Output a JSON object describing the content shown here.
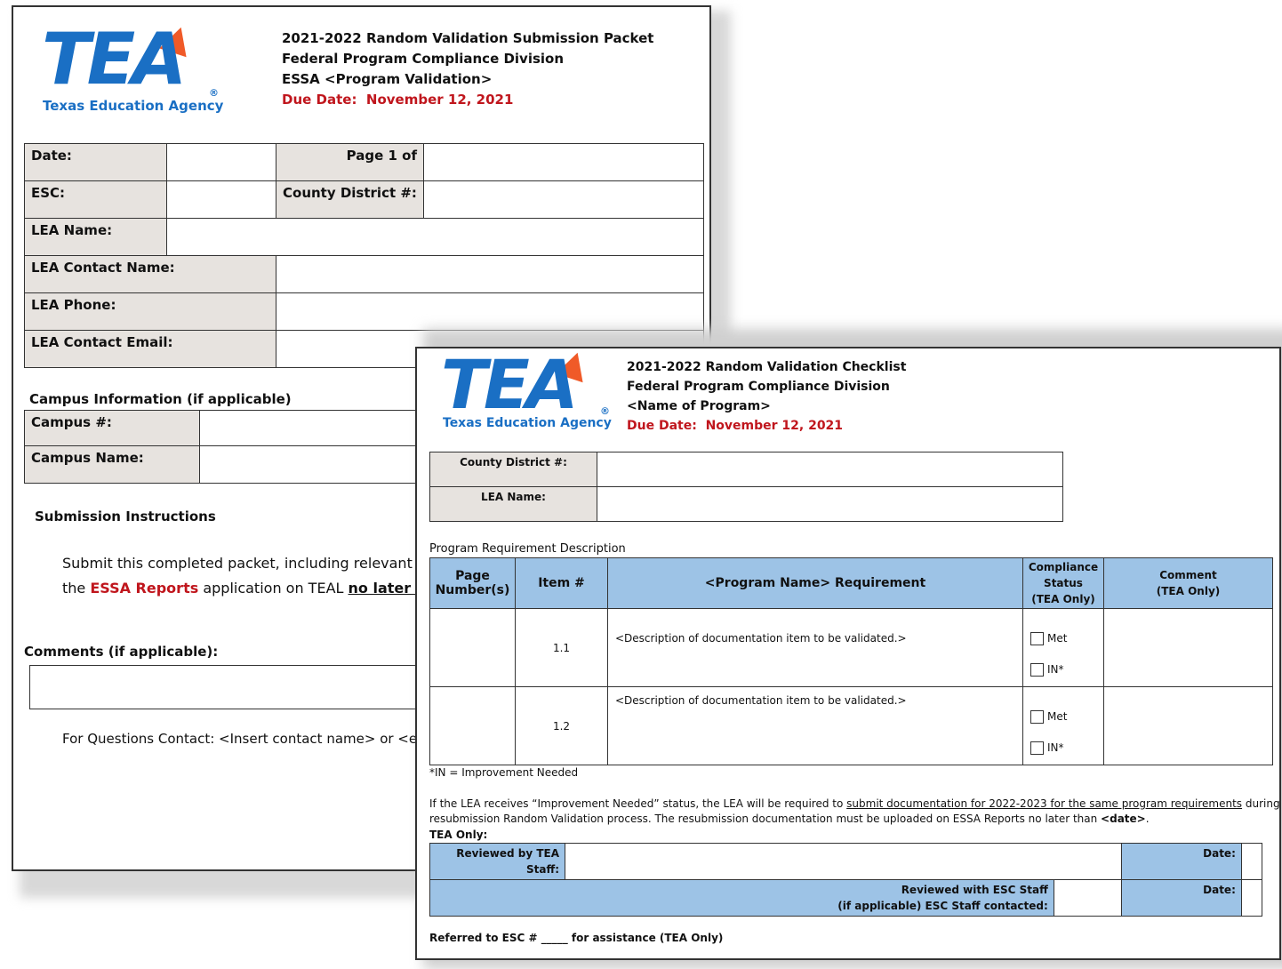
{
  "packet": {
    "logo_text": "TEA",
    "logo_subtitle": "Texas Education Agency",
    "title": "2021-2022 Random Validation Submission Packet",
    "division": "Federal Program Compliance Division",
    "program": "ESSA <Program Validation>",
    "due_label": "Due Date:",
    "due_value": "November 12, 2021",
    "date_label": "Date:",
    "page_label": "Page 1 of",
    "esc_label": "ESC:",
    "cd_label": "County District #:",
    "lea_name_label": "LEA Name:",
    "lea_contact_name_label": "LEA Contact Name:",
    "lea_phone_label": "LEA Phone:",
    "lea_contact_email_label": "LEA Contact Email:",
    "campus_info_heading": "Campus Information (if applicable)",
    "campus_num_label": "Campus #:",
    "campus_name_label": "Campus Name:",
    "submission_heading": "Submission Instructions",
    "submit_line1": "Submit this completed packet, including relevant d",
    "submit_line2_a": "the ",
    "submit_line2_b": "ESSA Reports",
    "submit_line2_c": " application on TEAL ",
    "submit_line2_d": "no later thar",
    "comments_heading": "Comments (if applicable):",
    "contact_line": "For Questions Contact: <Insert contact name> or <e"
  },
  "checklist": {
    "logo_text": "TEA",
    "logo_subtitle": "Texas Education Agency",
    "title": "2021-2022 Random Validation Checklist",
    "division": "Federal Program Compliance Division",
    "program": "<Name of Program>",
    "due_label": "Due Date:",
    "due_value": "November 12, 2021",
    "cd_label": "County District #:",
    "lea_label": "LEA Name:",
    "section_label": "Program Requirement Description",
    "col_page": "Page Number(s)",
    "col_item": "Item #",
    "col_req": "<Program Name> Requirement",
    "col_status_1": "Compliance",
    "col_status_2": "Status",
    "col_status_3": "(TEA Only)",
    "col_comment_1": "Comment",
    "col_comment_2": "(TEA Only)",
    "rows": [
      {
        "item": "1.1",
        "desc": "<Description of documentation item to be validated.>",
        "opt1": "Met",
        "opt2": "IN*"
      },
      {
        "item": "1.2",
        "desc": "<Description of documentation item to be validated.>",
        "opt1": "Met",
        "opt2": "IN*"
      }
    ],
    "footnote": "*IN = Improvement Needed",
    "para_a": "If the LEA receives “Improvement Needed” status, the LEA will be required to ",
    "para_link": "submit documentation for 2022-2023 for the same program requirements",
    "para_b": " during",
    "para_line2_a": "resubmission Random Validation process.  The resubmission documentation must be uploaded on ESSA Reports no later than ",
    "para_line2_b": "<date>",
    "para_line2_c": ".",
    "tea_only": "TEA Only:",
    "reviewed_tea_1": "Reviewed by TEA",
    "reviewed_tea_2": "Staff:",
    "date_label": "Date:",
    "reviewed_esc_1": "Reviewed with ESC Staff",
    "reviewed_esc_2": "(if applicable) ESC Staff contacted:",
    "referred_a": "Referred to ESC # ",
    "referred_blank": "_____",
    "referred_b": " for assistance (TEA Only)"
  },
  "colors": {
    "brand_blue": "#1a6fc4",
    "due_red": "#c0161d",
    "header_blue": "#9dc3e6",
    "label_grey": "#e7e3df"
  }
}
